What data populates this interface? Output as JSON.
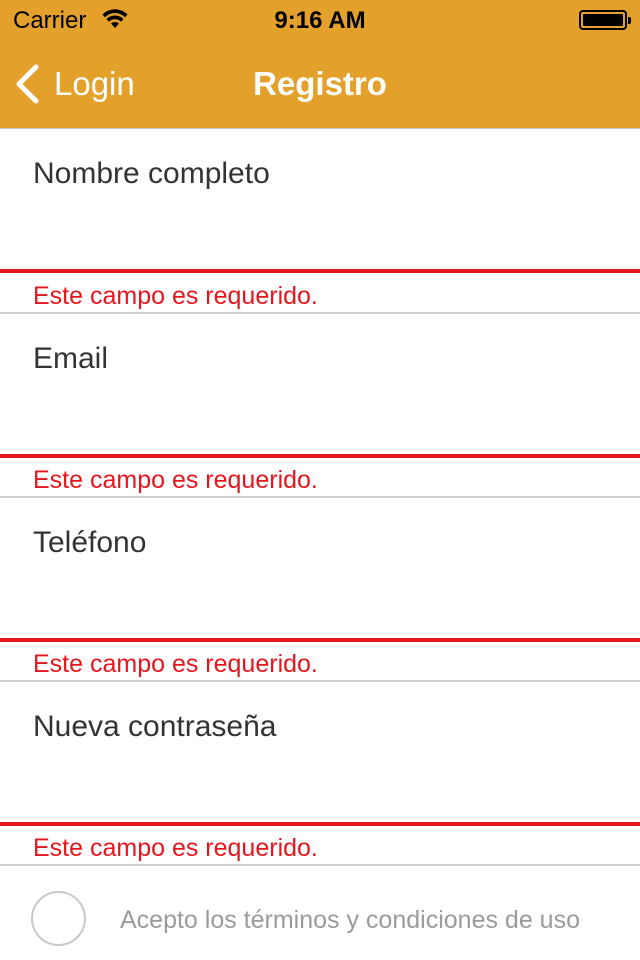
{
  "status_bar": {
    "carrier": "Carrier",
    "time": "9:16 AM",
    "battery_level": 1.0
  },
  "nav": {
    "back_label": "Login",
    "title": "Registro",
    "color": "#e3a12b"
  },
  "form": {
    "fields": [
      {
        "placeholder": "Nombre completo",
        "error": "Este campo es requerido."
      },
      {
        "placeholder": "Email",
        "error": "Este campo es requerido."
      },
      {
        "placeholder": "Teléfono",
        "error": "Este campo es requerido."
      },
      {
        "placeholder": "Nueva contraseña",
        "error": "Este campo es requerido."
      }
    ],
    "error_color": "#e5161e"
  },
  "terms": {
    "label": "Acepto los términos y condiciones de uso",
    "checked": false
  }
}
